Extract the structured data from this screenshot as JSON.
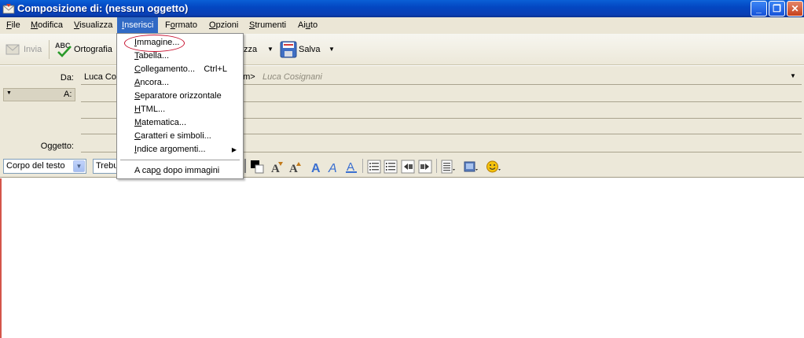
{
  "window": {
    "title": "Composizione di: (nessun oggetto)",
    "buttons": {
      "minimize": "_",
      "maximize": "❐",
      "close": "✕"
    }
  },
  "menubar": [
    {
      "label": "File",
      "mn": "F",
      "rest": "ile"
    },
    {
      "label": "Modifica",
      "mn": "M",
      "rest": "odifica"
    },
    {
      "label": "Visualizza",
      "mn": "V",
      "rest": "isualizza"
    },
    {
      "label": "Inserisci",
      "mn": "I",
      "rest": "nserisci"
    },
    {
      "label": "Formato",
      "mn": "o",
      "pre": "F",
      "rest": "rmato"
    },
    {
      "label": "Opzioni",
      "mn": "O",
      "rest": "pzioni"
    },
    {
      "label": "Strumenti",
      "mn": "S",
      "rest": "trumenti"
    },
    {
      "label": "Aiuto",
      "mn": "u",
      "pre": "Ai",
      "rest": "to"
    }
  ],
  "toolbar": {
    "send": "Invia",
    "spelling": "Ortografia",
    "security_partial": "zza",
    "save": "Salva"
  },
  "header": {
    "from_label": "Da:",
    "from_value_start": "Luca Cos",
    "from_value_end": "om>",
    "from_identity": "Luca Cosignani",
    "to_label": "A:",
    "subject_label": "Oggetto:"
  },
  "formatbar": {
    "paragraph_style": "Corpo del testo",
    "font_partial": "Trebu"
  },
  "dropdown": {
    "items": [
      {
        "pre": "",
        "mn": "I",
        "rest": "mmagine...",
        "shortcut": ""
      },
      {
        "pre": "",
        "mn": "T",
        "rest": "abella...",
        "shortcut": ""
      },
      {
        "pre": "",
        "mn": "C",
        "rest": "ollegamento...",
        "shortcut": "Ctrl+L"
      },
      {
        "pre": "",
        "mn": "A",
        "rest": "ncora...",
        "shortcut": ""
      },
      {
        "pre": "",
        "mn": "S",
        "rest": "eparatore orizzontale",
        "shortcut": ""
      },
      {
        "pre": "",
        "mn": "H",
        "rest": "TML...",
        "shortcut": ""
      },
      {
        "pre": "",
        "mn": "M",
        "rest": "atematica...",
        "shortcut": ""
      },
      {
        "pre": "",
        "mn": "C",
        "rest": "aratteri e simboli...",
        "shortcut": ""
      },
      {
        "pre": "",
        "mn": "I",
        "rest": "ndice argomenti...",
        "shortcut": "",
        "submenu": "▶"
      },
      {
        "pre": "A cap",
        "mn": "o",
        "rest": " dopo immagini",
        "shortcut": ""
      }
    ]
  },
  "colors": {
    "titlebar": "#0347c2",
    "menu_highlight": "#316ac5",
    "annotation": "#c8102e"
  }
}
